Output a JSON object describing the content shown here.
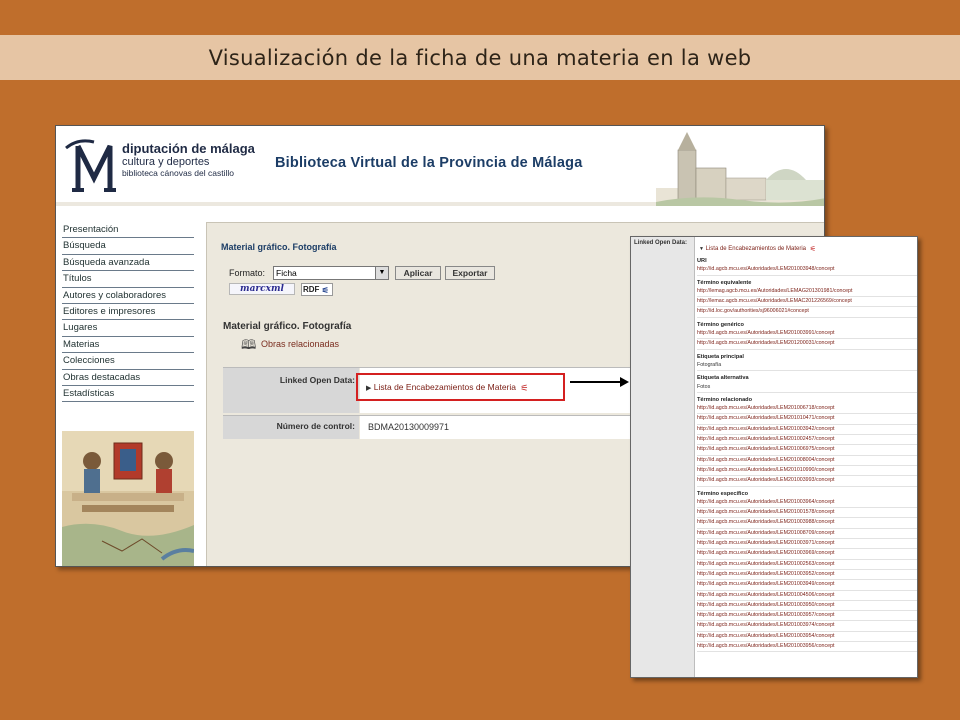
{
  "slide_title": "Visualización de la ficha de una materia en la web",
  "header": {
    "logo_line1": "diputación de málaga",
    "logo_line2": "cultura y deportes",
    "logo_line3": "biblioteca cánovas del castillo",
    "site_title": "Biblioteca Virtual de la Provincia de Málaga"
  },
  "sidebar": {
    "items": [
      {
        "label": "Presentación"
      },
      {
        "label": "Búsqueda"
      },
      {
        "label": "Búsqueda avanzada"
      },
      {
        "label": "Títulos"
      },
      {
        "label": "Autores y colaboradores"
      },
      {
        "label": "Editores e impresores"
      },
      {
        "label": "Lugares"
      },
      {
        "label": "Materias"
      },
      {
        "label": "Colecciones"
      },
      {
        "label": "Obras destacadas"
      },
      {
        "label": "Estadísticas"
      }
    ]
  },
  "main": {
    "breadcrumb": "Material gráfico. Fotografía",
    "format_label": "Formato:",
    "format_value": "Ficha",
    "apply_label": "Aplicar",
    "export_label": "Exportar",
    "marcxml_label": "MARCXML",
    "rdf_label": "RDF",
    "record_title": "Material gráfico. Fotografía",
    "related_works": "Obras relacionadas",
    "lod_label": "Linked Open Data:",
    "lod_link": "Lista de Encabezamientos de Materia",
    "control_label": "Número de control:",
    "control_value": "BDMA20130009971"
  },
  "popup": {
    "label": "Linked Open Data:",
    "head_link": "Lista de Encabezamientos de Materia",
    "uri_title": "URI",
    "uri": "http://id.agcb.mcu.es/Autoridades/LEM201003948/concept",
    "equiv_title": "Término equivalente",
    "equiv": [
      "http://lemag.agcb.mcu.es/Autoridades/LEMAG201301981/concept",
      "http://lemac.agcb.mcu.es/Autoridades/LEMAC201226569/concept",
      "http://id.loc.gov/authorities/sj96006021#concept"
    ],
    "generic_title": "Término genérico",
    "generic": [
      "http://id.agcb.mcu.es/Autoridades/LEM201003991/concept",
      "http://id.agcb.mcu.es/Autoridades/LEM201200031/concept"
    ],
    "pref_title": "Etiqueta principal",
    "pref": "Fotografía",
    "alt_title": "Etiqueta alternativa",
    "alt": "Fotos",
    "related_title": "Término relacionado",
    "related": [
      "http://id.agcb.mcu.es/Autoridades/LEM201006718/concept",
      "http://id.agcb.mcu.es/Autoridades/LEM201010471/concept",
      "http://id.agcb.mcu.es/Autoridades/LEM201003942/concept",
      "http://id.agcb.mcu.es/Autoridades/LEM201002457/concept",
      "http://id.agcb.mcu.es/Autoridades/LEM201006975/concept",
      "http://id.agcb.mcu.es/Autoridades/LEM201008004/concept",
      "http://id.agcb.mcu.es/Autoridades/LEM201010990/concept",
      "http://id.agcb.mcu.es/Autoridades/LEM201003993/concept"
    ],
    "specific_title": "Término específico",
    "specific": [
      "http://id.agcb.mcu.es/Autoridades/LEM201003964/concept",
      "http://id.agcb.mcu.es/Autoridades/LEM201001578/concept",
      "http://id.agcb.mcu.es/Autoridades/LEM201003988/concept",
      "http://id.agcb.mcu.es/Autoridades/LEM201008709/concept",
      "http://id.agcb.mcu.es/Autoridades/LEM201003971/concept",
      "http://id.agcb.mcu.es/Autoridades/LEM201003969/concept",
      "http://id.agcb.mcu.es/Autoridades/LEM201002563/concept",
      "http://id.agcb.mcu.es/Autoridades/LEM201003952/concept",
      "http://id.agcb.mcu.es/Autoridades/LEM201003949/concept",
      "http://id.agcb.mcu.es/Autoridades/LEM201004506/concept",
      "http://id.agcb.mcu.es/Autoridades/LEM201003950/concept",
      "http://id.agcb.mcu.es/Autoridades/LEM201003957/concept",
      "http://id.agcb.mcu.es/Autoridades/LEM201003974/concept",
      "http://id.agcb.mcu.es/Autoridades/LEM201003954/concept",
      "http://id.agcb.mcu.es/Autoridades/LEM201003956/concept"
    ]
  },
  "colors": {
    "background": "#bf6e2c",
    "title_band": "#e6c5a4",
    "highlight": "#d42020",
    "link": "#7a1d14"
  }
}
